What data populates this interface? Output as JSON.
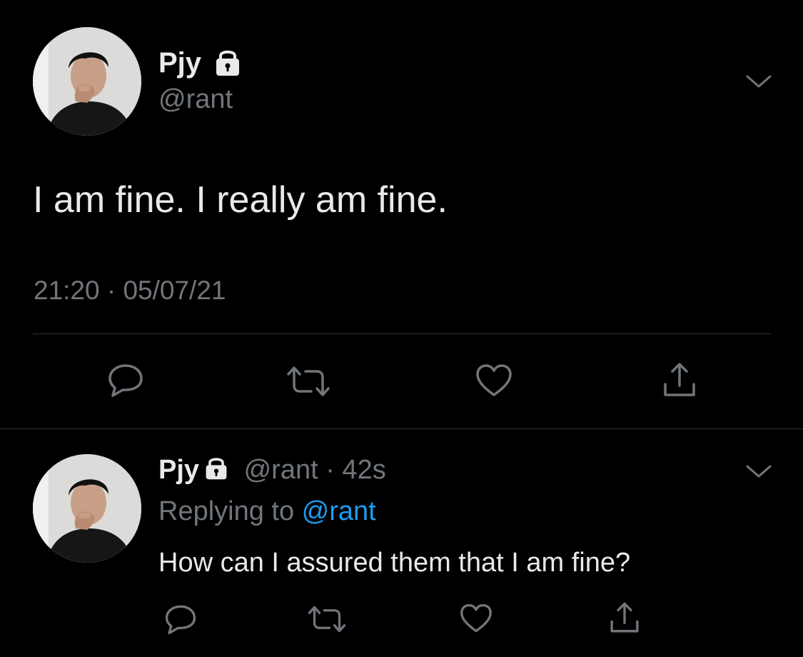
{
  "main_tweet": {
    "display_name": "Pjy",
    "handle": "@rant",
    "text": "I am fine. I really am fine.",
    "meta": "21:20 · 05/07/21",
    "icons": [
      "lock-icon",
      "chevron-down-icon",
      "reply-icon",
      "retweet-icon",
      "like-icon",
      "share-icon"
    ]
  },
  "reply_tweet": {
    "display_name": "Pjy",
    "handle_time": " @rant · 42s",
    "replying_prefix": "Replying to ",
    "replying_mention": "@rant",
    "text": "How can I assured them that I am fine?",
    "icons": [
      "lock-icon",
      "chevron-down-icon",
      "reply-icon",
      "retweet-icon",
      "like-icon",
      "share-icon"
    ]
  },
  "colors": {
    "background": "#000000",
    "primary_text": "#e7e9ea",
    "secondary_text": "#71767b",
    "accent": "#1d9bf0",
    "divider": "#2f3336"
  }
}
